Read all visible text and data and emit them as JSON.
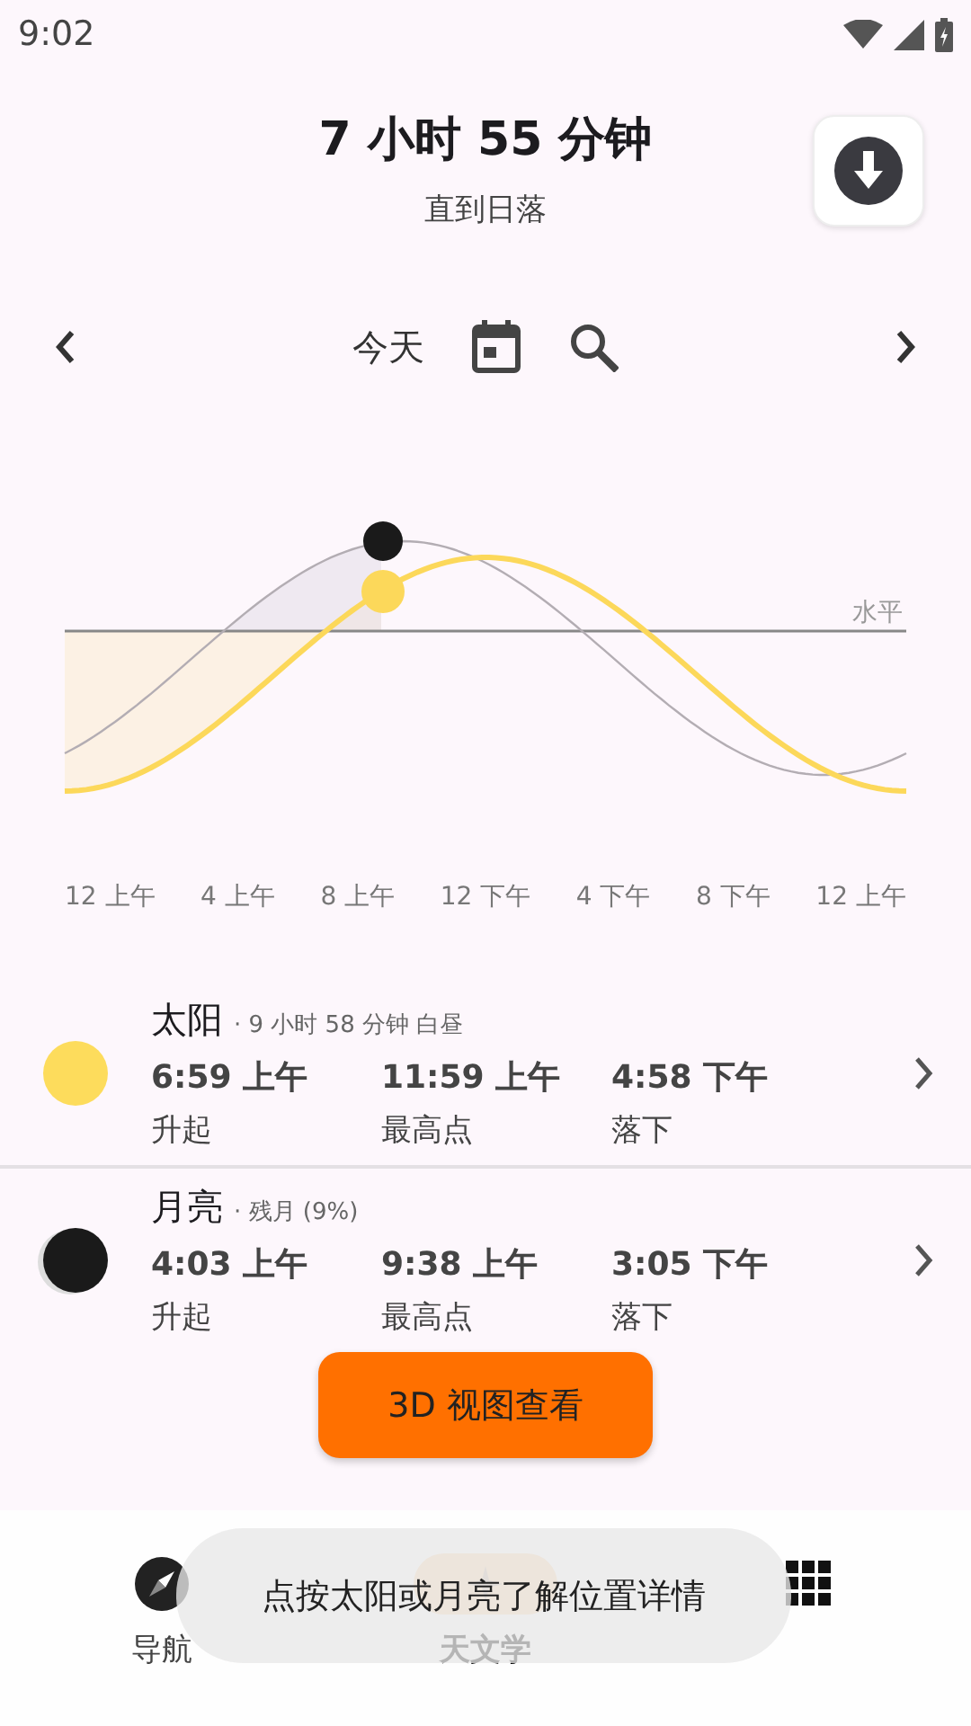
{
  "status_bar": {
    "time": "9:02"
  },
  "header": {
    "title": "7 小时 55 分钟",
    "subtitle": "直到日落"
  },
  "date_nav": {
    "label": "今天"
  },
  "chart": {
    "horizon_label": "水平",
    "time_labels": [
      "12 上午",
      "4 上午",
      "8 上午",
      "12 下午",
      "4 下午",
      "8 下午",
      "12 上午"
    ]
  },
  "bodies": [
    {
      "kind": "sun",
      "name": "太阳",
      "detail": "· 9 小时 58 分钟 白昼",
      "events": [
        {
          "time": "6:59 上午",
          "label": "升起"
        },
        {
          "time": "11:59 上午",
          "label": "最高点"
        },
        {
          "time": "4:58 下午",
          "label": "落下"
        }
      ]
    },
    {
      "kind": "moon",
      "name": "月亮",
      "detail": "· 残月 (9%)",
      "events": [
        {
          "time": "4:03 上午",
          "label": "升起"
        },
        {
          "time": "9:38 上午",
          "label": "最高点"
        },
        {
          "time": "3:05 下午",
          "label": "落下"
        }
      ]
    }
  ],
  "view_button": {
    "label": "3D 视图查看"
  },
  "bottom_nav": [
    {
      "label": "导航",
      "selected": false
    },
    {
      "label": "天文学",
      "selected": true
    },
    {
      "selected": false
    }
  ],
  "toast": {
    "text": "点按太阳或月亮了解位置详情"
  }
}
